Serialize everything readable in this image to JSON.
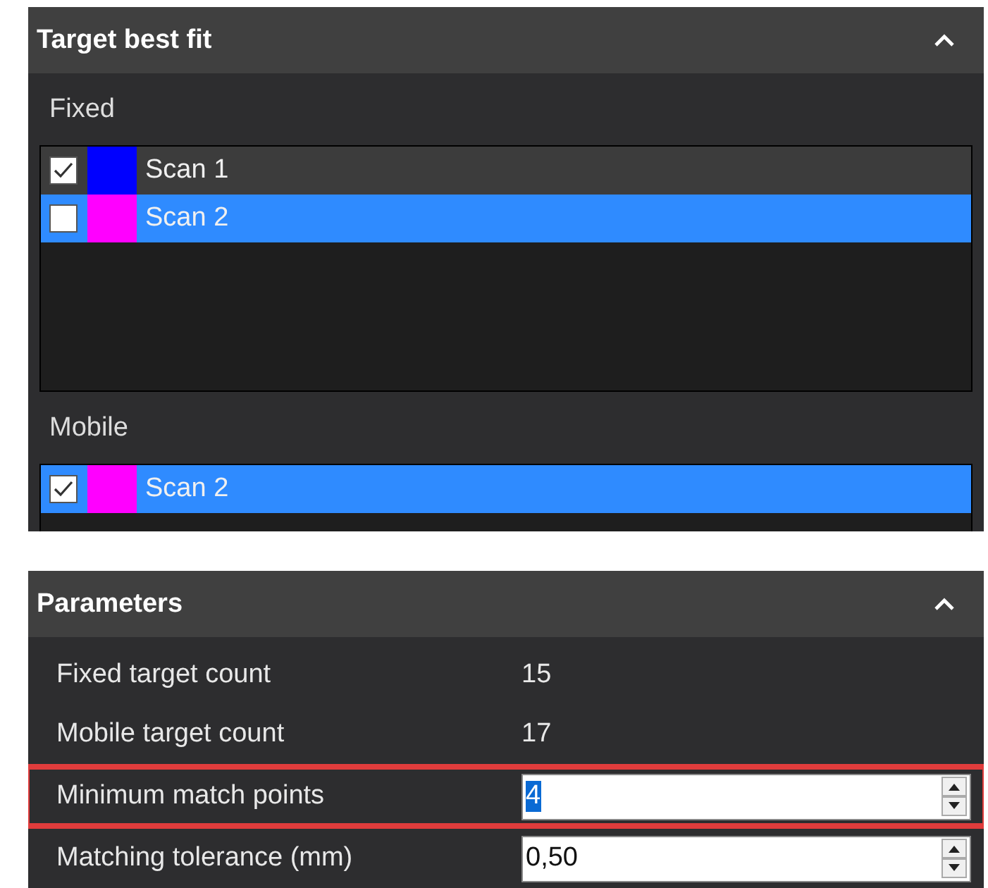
{
  "panels": [
    {
      "title": "Target best fit",
      "expanded": true,
      "kind": "lists",
      "groups": [
        {
          "label": "Fixed",
          "items": [
            {
              "name": "Scan 1",
              "checked": true,
              "selected": false,
              "color": "#0000ff"
            },
            {
              "name": "Scan 2",
              "checked": false,
              "selected": true,
              "color": "#ff00ff"
            }
          ]
        },
        {
          "label": "Mobile",
          "items": [
            {
              "name": "Scan 2",
              "checked": true,
              "selected": true,
              "color": "#ff00ff"
            }
          ]
        }
      ]
    },
    {
      "title": "Parameters",
      "expanded": true,
      "kind": "params",
      "rows": [
        {
          "kind": "readout",
          "label": "Fixed target count",
          "value": "15",
          "highlighted": false
        },
        {
          "kind": "readout",
          "label": "Mobile target count",
          "value": "17",
          "highlighted": false
        },
        {
          "kind": "spinner",
          "label": "Minimum match points",
          "value": "4",
          "text_selected": true,
          "highlighted": true
        },
        {
          "kind": "spinner",
          "label": "Matching tolerance (mm)",
          "value": "0,50",
          "text_selected": false,
          "highlighted": false
        }
      ]
    }
  ]
}
